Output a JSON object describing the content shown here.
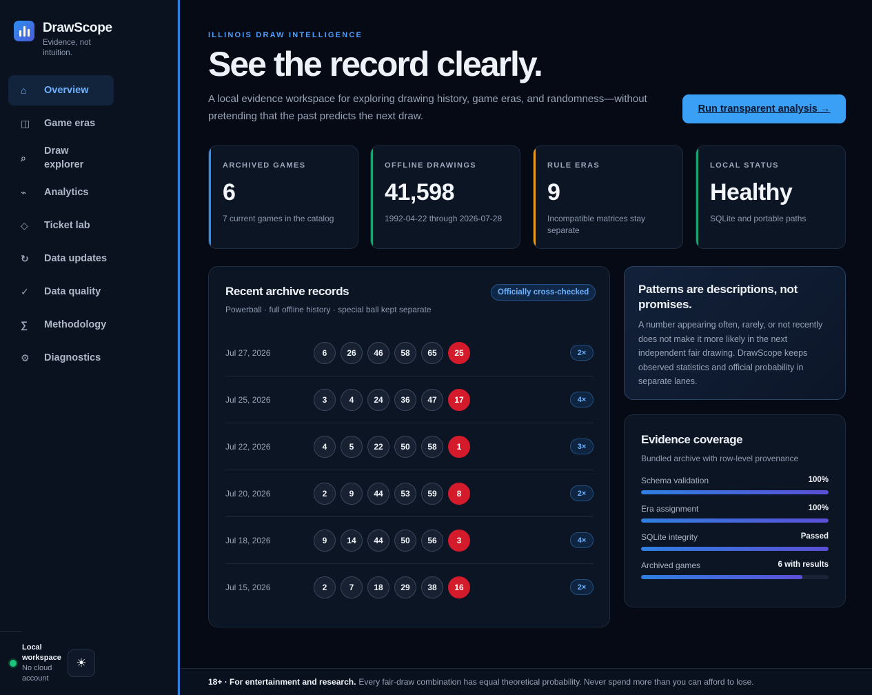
{
  "brand": {
    "title": "DrawScope",
    "subtitle": "Evidence, not intuition."
  },
  "nav": [
    {
      "label": "Overview",
      "icon": "⌂",
      "icon_name": "home-icon",
      "active": true
    },
    {
      "label": "Game eras",
      "icon": "◫",
      "icon_name": "columns-icon"
    },
    {
      "label": "Draw explorer",
      "icon": "⌕",
      "icon_name": "search-icon"
    },
    {
      "label": "Analytics",
      "icon": "⌁",
      "icon_name": "pulse-icon"
    },
    {
      "label": "Ticket lab",
      "icon": "◇",
      "icon_name": "diamond-icon"
    },
    {
      "label": "Data updates",
      "icon": "↻",
      "icon_name": "refresh-icon"
    },
    {
      "label": "Data quality",
      "icon": "✓",
      "icon_name": "check-icon"
    },
    {
      "label": "Methodology",
      "icon": "∑",
      "icon_name": "sigma-icon"
    },
    {
      "label": "Diagnostics",
      "icon": "⚙",
      "icon_name": "gear-icon"
    }
  ],
  "workspace": {
    "title": "Local workspace",
    "status": "No cloud account",
    "status_color": "#1bc47d"
  },
  "theme_toggle": {
    "icon": "☀",
    "icon_name": "sun-icon"
  },
  "hero": {
    "eyebrow": "ILLINOIS DRAW INTELLIGENCE",
    "title": "See the record clearly.",
    "description": "A local evidence workspace for exploring drawing history, game eras, and randomness—without pretending that the past predicts the next draw.",
    "cta": "Run transparent analysis →"
  },
  "stats": [
    {
      "label": "ARCHIVED GAMES",
      "value": "6",
      "sub": "7 current games in the catalog",
      "accent": "#2f8ff0"
    },
    {
      "label": "OFFLINE DRAWINGS",
      "value": "41,598",
      "sub": "1992-04-22 through 2026-07-28",
      "accent": "#1aa575"
    },
    {
      "label": "RULE ERAS",
      "value": "9",
      "sub": "Incompatible matrices stay separate",
      "accent": "#e89a1c"
    },
    {
      "label": "LOCAL STATUS",
      "value": "Healthy",
      "sub": "SQLite and portable paths",
      "accent": "#1aa575"
    }
  ],
  "records": {
    "title": "Recent archive records",
    "subtitle": "Powerball · full offline history · special ball kept separate",
    "badge": "Officially cross-checked",
    "rows": [
      {
        "date": "Jul 27, 2026",
        "balls": [
          "6",
          "26",
          "46",
          "58",
          "65"
        ],
        "special": "25",
        "multiplier": "2×"
      },
      {
        "date": "Jul 25, 2026",
        "balls": [
          "3",
          "4",
          "24",
          "36",
          "47"
        ],
        "special": "17",
        "multiplier": "4×"
      },
      {
        "date": "Jul 22, 2026",
        "balls": [
          "4",
          "5",
          "22",
          "50",
          "58"
        ],
        "special": "1",
        "multiplier": "3×"
      },
      {
        "date": "Jul 20, 2026",
        "balls": [
          "2",
          "9",
          "44",
          "53",
          "59"
        ],
        "special": "8",
        "multiplier": "2×"
      },
      {
        "date": "Jul 18, 2026",
        "balls": [
          "9",
          "14",
          "44",
          "50",
          "56"
        ],
        "special": "3",
        "multiplier": "4×"
      },
      {
        "date": "Jul 15, 2026",
        "balls": [
          "2",
          "7",
          "18",
          "29",
          "38"
        ],
        "special": "16",
        "multiplier": "2×"
      }
    ]
  },
  "patterns": {
    "title": "Patterns are descriptions, not promises.",
    "body": "A number appearing often, rarely, or not recently does not make it more likely in the next independent fair drawing. DrawScope keeps observed statistics and official probability in separate lanes."
  },
  "coverage": {
    "title": "Evidence coverage",
    "subtitle": "Bundled archive with row-level provenance",
    "items": [
      {
        "label": "Schema validation",
        "value": "100%",
        "fraction": 1.0
      },
      {
        "label": "Era assignment",
        "value": "100%",
        "fraction": 1.0
      },
      {
        "label": "SQLite integrity",
        "value": "Passed",
        "fraction": 1.0
      },
      {
        "label": "Archived games",
        "value": "6 with results",
        "fraction": 0.86
      }
    ]
  },
  "footer": {
    "emphasis": "18+ · For entertainment and research.",
    "text": "Every fair-draw combination has equal theoretical probability. Never spend more than you can afford to lose."
  }
}
